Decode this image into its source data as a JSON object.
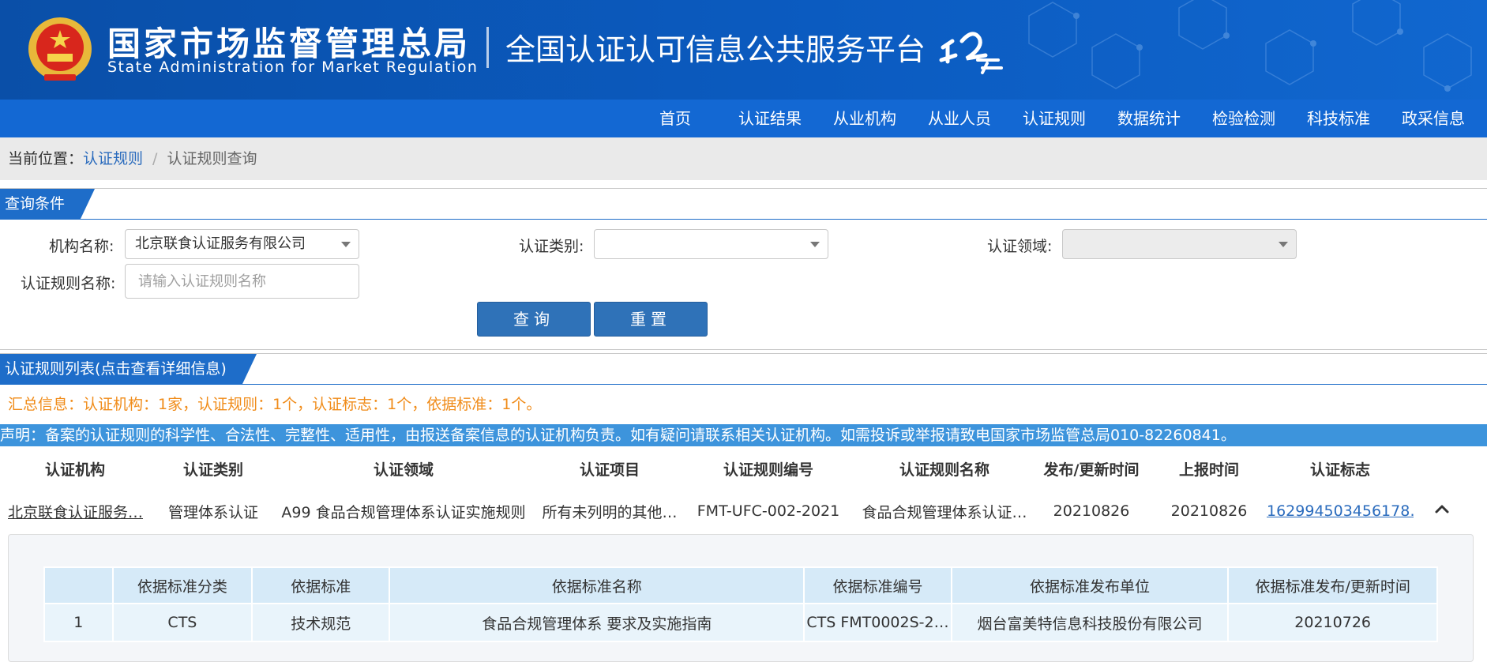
{
  "header": {
    "brand_cn": "国家市场监督管理总局",
    "brand_en": "State Administration for Market Regulation",
    "platform_title": "全国认证认可信息公共服务平台",
    "cloud_logo_icon": "renzheng-cloud-logo-icon",
    "emblem_icon": "national-emblem-icon",
    "primary_color": "#0b5bc0"
  },
  "nav": {
    "items": [
      "首页",
      "认证结果",
      "从业机构",
      "从业人员",
      "认证规则",
      "数据统计",
      "检验检测",
      "科技标准",
      "政采信息"
    ]
  },
  "breadcrumb": {
    "prefix": "当前位置：",
    "link": "认证规则",
    "separator": "/",
    "current": "认证规则查询"
  },
  "query": {
    "section_title": "查询条件",
    "org_label": "机构名称:",
    "org_value": "北京联食认证服务有限公司",
    "category_label": "认证类别:",
    "category_value": "",
    "domain_label": "认证领域:",
    "domain_value": "",
    "rule_name_label": "认证规则名称:",
    "rule_name_placeholder": "请输入认证规则名称",
    "search_button": "查询",
    "reset_button": "重置"
  },
  "list": {
    "section_title": "认证规则列表(点击查看详细信息)",
    "summary": "汇总信息：认证机构：1家，认证规则：1个，认证标志：1个，依据标准：1个。",
    "notice": "声明：备案的认证规则的科学性、合法性、完整性、适用性，由报送备案信息的认证机构负责。如有疑问请联系相关认证机构。如需投诉或举报请致电国家市场监管总局010-82260841。",
    "columns": [
      "认证机构",
      "认证类别",
      "认证领域",
      "认证项目",
      "认证规则编号",
      "认证规则名称",
      "发布/更新时间",
      "上报时间",
      "认证标志"
    ],
    "rows": [
      {
        "org": "北京联食认证服务…",
        "category": "管理体系认证",
        "domain": "A99 食品合规管理体系认证实施规则",
        "project": "所有未列明的其他…",
        "rule_no": "FMT-UFC-002-2021",
        "rule_name": "食品合规管理体系认证…",
        "publish_time": "20210826",
        "report_time": "20210826",
        "mark": "162994503456178…"
      }
    ],
    "collapse_icon": "chevron-up-icon"
  },
  "standards": {
    "columns": [
      "",
      "依据标准分类",
      "依据标准",
      "依据标准名称",
      "依据标准编号",
      "依据标准发布单位",
      "依据标准发布/更新时间"
    ],
    "rows": [
      {
        "index": "1",
        "category": "CTS",
        "standard": "技术规范",
        "name": "食品合规管理体系 要求及实施指南",
        "code": "CTS FMT0002S-2…",
        "issuer": "烟台富美特信息科技股份有限公司",
        "time": "20210726"
      }
    ]
  }
}
